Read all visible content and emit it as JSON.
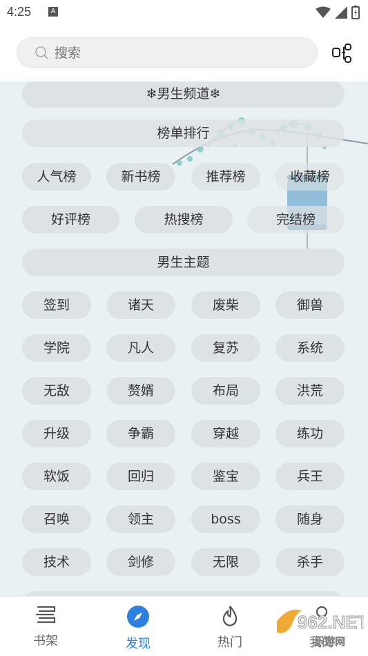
{
  "status": {
    "time": "4:25",
    "a_badge": "A"
  },
  "search": {
    "placeholder": "搜索"
  },
  "sections": {
    "channel": "❄男生频道❄",
    "rank_title": "榜单排行",
    "theme_title": "男生主题"
  },
  "rank_tags": [
    "人气榜",
    "新书榜",
    "推荐榜",
    "收藏榜",
    "好评榜",
    "热搜榜",
    "完结榜"
  ],
  "theme_tags": [
    "签到",
    "诸天",
    "废柴",
    "御兽",
    "学院",
    "凡人",
    "复苏",
    "系统",
    "无敌",
    "赘婿",
    "布局",
    "洪荒",
    "升级",
    "争霸",
    "穿越",
    "练功",
    "软饭",
    "回归",
    "鉴宝",
    "兵王",
    "召唤",
    "领主",
    "boss",
    "随身",
    "技术",
    "剑修",
    "无限",
    "杀手"
  ],
  "nav": [
    {
      "label": "书架",
      "icon": "bookshelf-icon"
    },
    {
      "label": "发现",
      "icon": "compass-icon",
      "active": true
    },
    {
      "label": "热门",
      "icon": "fire-icon"
    },
    {
      "label": "我的",
      "icon": "profile-icon"
    }
  ],
  "watermark": {
    "brand": "962.NET",
    "sub": "乐游网"
  },
  "colors": {
    "accent": "#2f7fe0",
    "pill": "#dde2e4",
    "background": "#e9f1f2"
  }
}
